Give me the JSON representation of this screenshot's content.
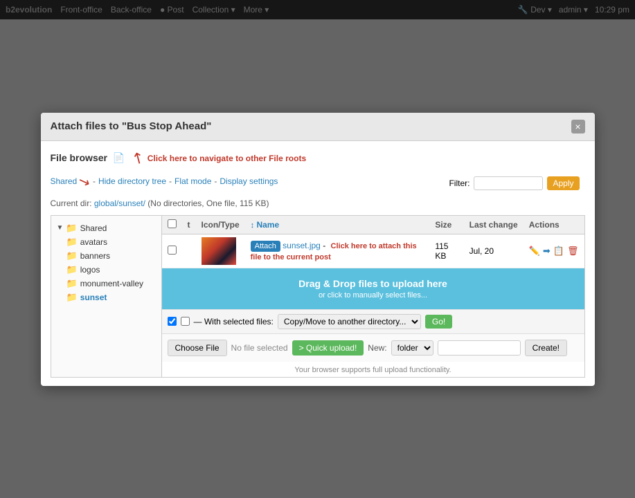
{
  "topbar": {
    "brand": "b2evolution",
    "items": [
      "Front-office",
      "Back-office",
      "Post",
      "Collection",
      "More"
    ],
    "right": [
      "Dev",
      "admin",
      "10:29 pm"
    ]
  },
  "modal": {
    "title": "Attach files to \"Bus Stop Ahead\"",
    "close_label": "×"
  },
  "filebrowser": {
    "title": "File browser",
    "hint": "Click here to navigate to other File roots",
    "nav": {
      "shared_label": "Shared",
      "hide_tree": "Hide directory tree",
      "flat_mode": "Flat mode",
      "display_settings": "Display settings"
    },
    "current_dir_prefix": "Current dir:",
    "current_dir_path": "global/sunset/",
    "current_dir_info": "(No directories, One file, 115 KB)",
    "filter_label": "Filter:",
    "apply_label": "Apply",
    "tree": {
      "root": "Shared",
      "children": [
        "avatars",
        "banners",
        "logos",
        "monument-valley",
        "sunset"
      ]
    },
    "table": {
      "headers": [
        "",
        "t",
        "Icon/Type",
        "Name",
        "Size",
        "Last change",
        "Actions"
      ],
      "rows": [
        {
          "name": "sunset.jpg",
          "has_attach": true,
          "attach_label": "Attach",
          "separator": "-",
          "size": "115 KB",
          "last_change": "Jul, 20",
          "actions": [
            "edit",
            "arrow",
            "copy",
            "trash"
          ]
        }
      ]
    },
    "attach_hint": "Click here to attach this file to the current post",
    "dnd": {
      "main": "Drag & Drop files to upload here",
      "sub": "or click to manually select files..."
    },
    "selected": {
      "label": "— With selected files:",
      "move_option": "Copy/Move to another directory...",
      "go_label": "Go!"
    },
    "upload": {
      "choose_label": "Choose File",
      "no_file_label": "No file selected",
      "quick_upload_label": "> Quick upload!",
      "new_label": "New:",
      "folder_option": "folder",
      "new_name_placeholder": "",
      "create_label": "Create!"
    },
    "support_note": "Your browser supports full upload functionality."
  }
}
